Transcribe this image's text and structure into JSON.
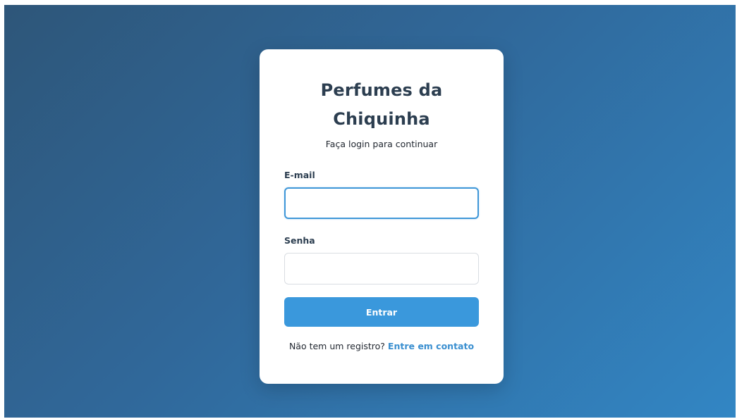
{
  "login": {
    "title": "Perfumes da Chiquinha",
    "subtitle": "Faça login para continuar",
    "email_label": "E-mail",
    "email_value": "",
    "password_label": "Senha",
    "password_value": "",
    "submit_label": "Entrar",
    "footer_text": "Não tem um registro?",
    "footer_link": "Entre em contato"
  },
  "colors": {
    "accent": "#3a98dc",
    "title_text": "#2c3e50",
    "background_start": "#2e5679",
    "background_end": "#3286c4"
  }
}
